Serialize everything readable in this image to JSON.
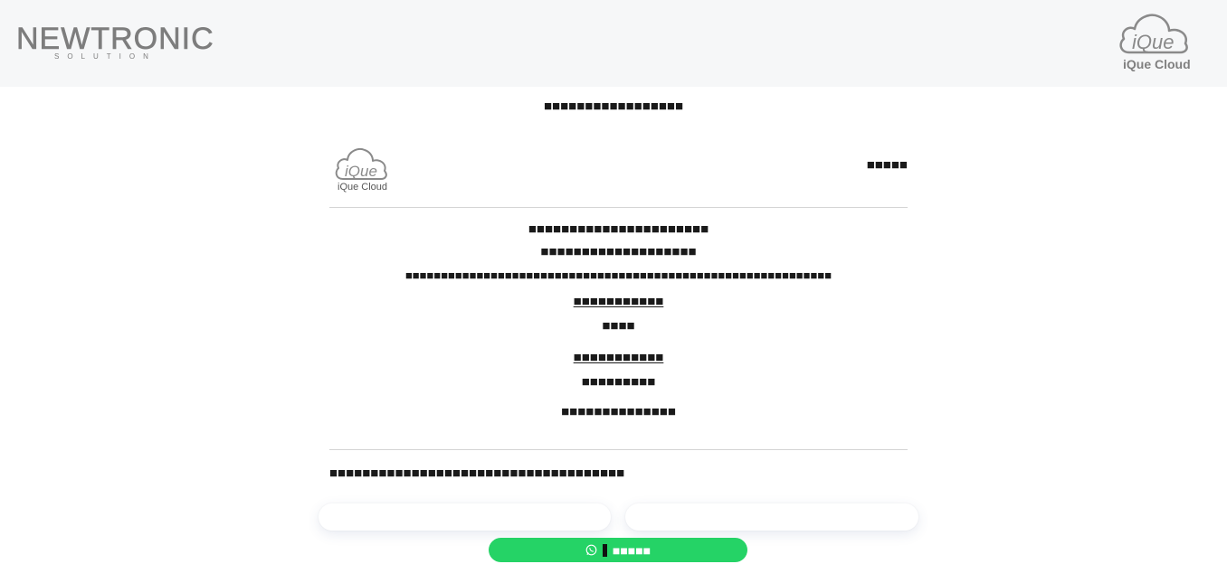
{
  "header": {
    "brand_name": "NEWTRONIC",
    "brand_tagline": "SOLUTION",
    "product_logo_text": "iQue",
    "product_caption": "iQue Cloud"
  },
  "page": {
    "heading": "■■■■■■■■■■■■■■■■■"
  },
  "card": {
    "logo_text": "iQue",
    "logo_caption": "iQue Cloud",
    "right_label": "■■■■■",
    "lines": [
      "■■■■■■■■■■■■■■■■■■■■■■",
      "■■■■■■■■■■■■■■■■■■■",
      "■■■■■■■■■■■■■■■■■■■■■■■■■■■■■■■■■■■■■■■■■■■■■■■■■■■■■■■■■■■■",
      "■■■■■■■■■■■",
      "■■■■",
      "■■■■■■■■■■■",
      "■■■■■■■■■",
      "■■■■■■■■■■■■■■"
    ],
    "notice": "■■■■■■■■■■■■■■■■■■■■■■■■■■■■■■■■■■■■"
  },
  "form": {
    "field_left_placeholder": "",
    "field_right_placeholder": "",
    "whatsapp_label": "■■■■■"
  },
  "colors": {
    "topbar_bg": "#f6f7f8",
    "whatsapp_green": "#25d366",
    "logo_gray": "#7d7d7d"
  },
  "icons": {
    "whatsapp": "whatsapp-icon",
    "cloud": "cloud-icon"
  }
}
